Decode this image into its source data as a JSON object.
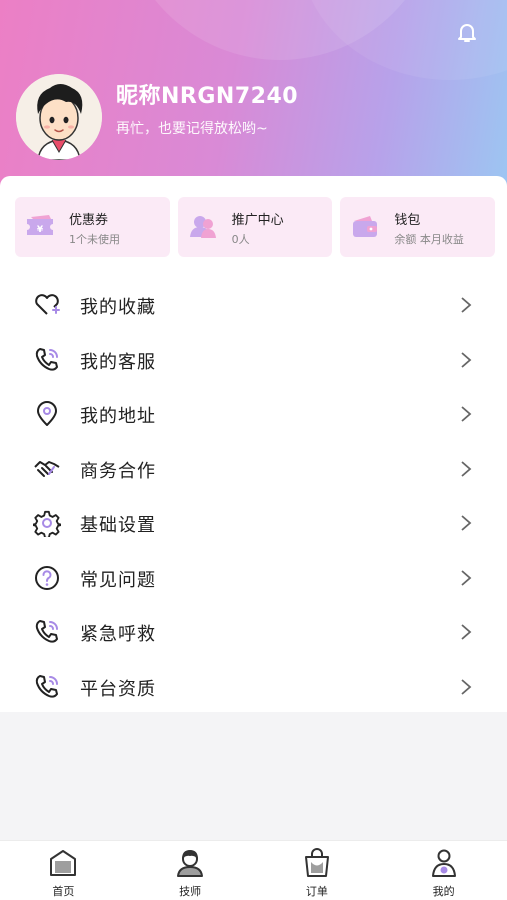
{
  "colors": {
    "accent": "#a78ae6",
    "header_start": "#ec7fc5",
    "header_end": "#9cc6f2",
    "quick_bg": "#fbeaf6"
  },
  "header": {
    "bell_icon": "bell-icon",
    "nickname": "昵称NRGN7240",
    "motto": "再忙，也要记得放松哟~"
  },
  "quick": [
    {
      "icon": "coupon-icon",
      "title": "优惠券",
      "sub": "1个未使用"
    },
    {
      "icon": "users-icon",
      "title": "推广中心",
      "sub": "0人"
    },
    {
      "icon": "wallet-icon",
      "title": "钱包",
      "sub": "余额 本月收益"
    }
  ],
  "menu": [
    {
      "icon": "heart-plus-icon",
      "label": "我的收藏"
    },
    {
      "icon": "phone-icon",
      "label": "我的客服"
    },
    {
      "icon": "location-icon",
      "label": "我的地址"
    },
    {
      "icon": "handshake-icon",
      "label": "商务合作"
    },
    {
      "icon": "gear-icon",
      "label": "基础设置"
    },
    {
      "icon": "question-icon",
      "label": "常见问题"
    },
    {
      "icon": "phone-icon",
      "label": "紧急呼救"
    },
    {
      "icon": "phone-icon",
      "label": "平台资质"
    }
  ],
  "tabs": [
    {
      "icon": "home-icon",
      "label": "首页"
    },
    {
      "icon": "technician-icon",
      "label": "技师"
    },
    {
      "icon": "order-bag-icon",
      "label": "订单"
    },
    {
      "icon": "person-icon",
      "label": "我的"
    }
  ]
}
